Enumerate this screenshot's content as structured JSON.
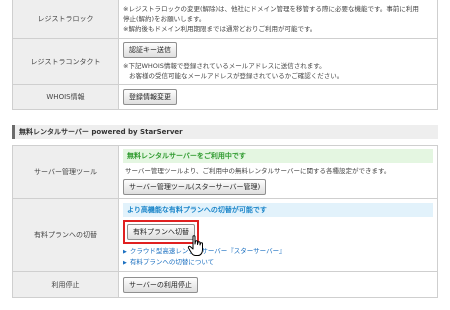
{
  "domain_settings": {
    "rows": [
      {
        "label": "レジストラロック",
        "notes": [
          "※レジストラロックの変更(解除)は、他社にドメイン管理を移管する際に必要な機能です。事前に利用",
          "停止(解約)をお願いします。",
          "※解約後もドメイン利用期限までは通常どおりご利用が可能です。"
        ]
      },
      {
        "label": "レジストラコンタクト",
        "button": "認証キー送信",
        "notes": [
          "※下記WHOIS情報で登録されているメールアドレスに送信されます。",
          "お客様の受信可能なメールアドレスが登録されているかご確認ください。"
        ]
      },
      {
        "label": "WHOIS情報",
        "button": "登録情報変更"
      }
    ]
  },
  "rental_section": {
    "title": "無料レンタルサーバー powered by StarServer"
  },
  "rental_rows": {
    "server_tool": {
      "label": "サーバー管理ツール",
      "status": "無料レンタルサーバーをご利用中です",
      "desc": "サーバー管理ツールより、ご利用中の無料レンタルサーバーに関する各種設定ができます。",
      "button": "サーバー管理ツール(スターサーバー管理)"
    },
    "plan_switch": {
      "label": "有料プランへの切替",
      "status": "より高機能な有料プランへの切替が可能です",
      "button": "有料プランへ切替",
      "links": [
        "クラウド型高速レンタルサーバー『スターサーバー』",
        "有料プランへの切替について"
      ]
    },
    "stop": {
      "label": "利用停止",
      "button": "サーバーの利用停止"
    }
  },
  "colors": {
    "highlight_border": "#e02020",
    "green_status": "#2e9a2e",
    "blue_status": "#1a85c9",
    "link": "#1a6fc0"
  },
  "icons": {
    "cursor": "hand-pointer-icon",
    "link_bullet": "triangle-right-icon"
  }
}
